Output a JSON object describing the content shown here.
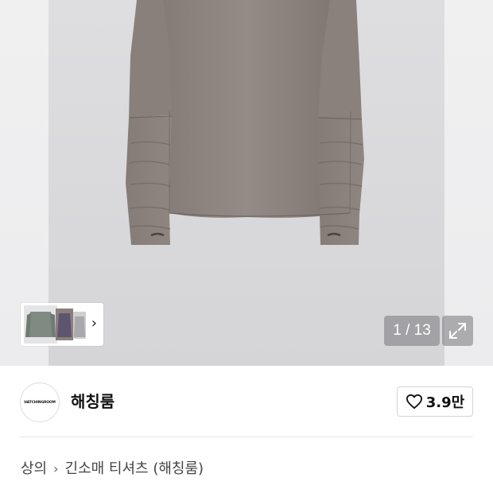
{
  "gallery": {
    "counter": "1 / 13",
    "expand_icon": "expand-icon",
    "thumb_chevron_icon": "chevron-right-icon"
  },
  "brand": {
    "logo_text": "HATCHINGROOM",
    "name": "해칭룸",
    "like_count": "3.9만",
    "like_icon": "heart-outline-icon"
  },
  "breadcrumb": {
    "category": "상의",
    "separator_icon": "chevron-right-icon",
    "subcategory": "긴소매 티셔츠 (해칭룸)"
  },
  "colors": {
    "product_fabric": "#8c837f",
    "panel_bg": "#d9d9dc",
    "overlay_bg": "#7c7c80"
  }
}
